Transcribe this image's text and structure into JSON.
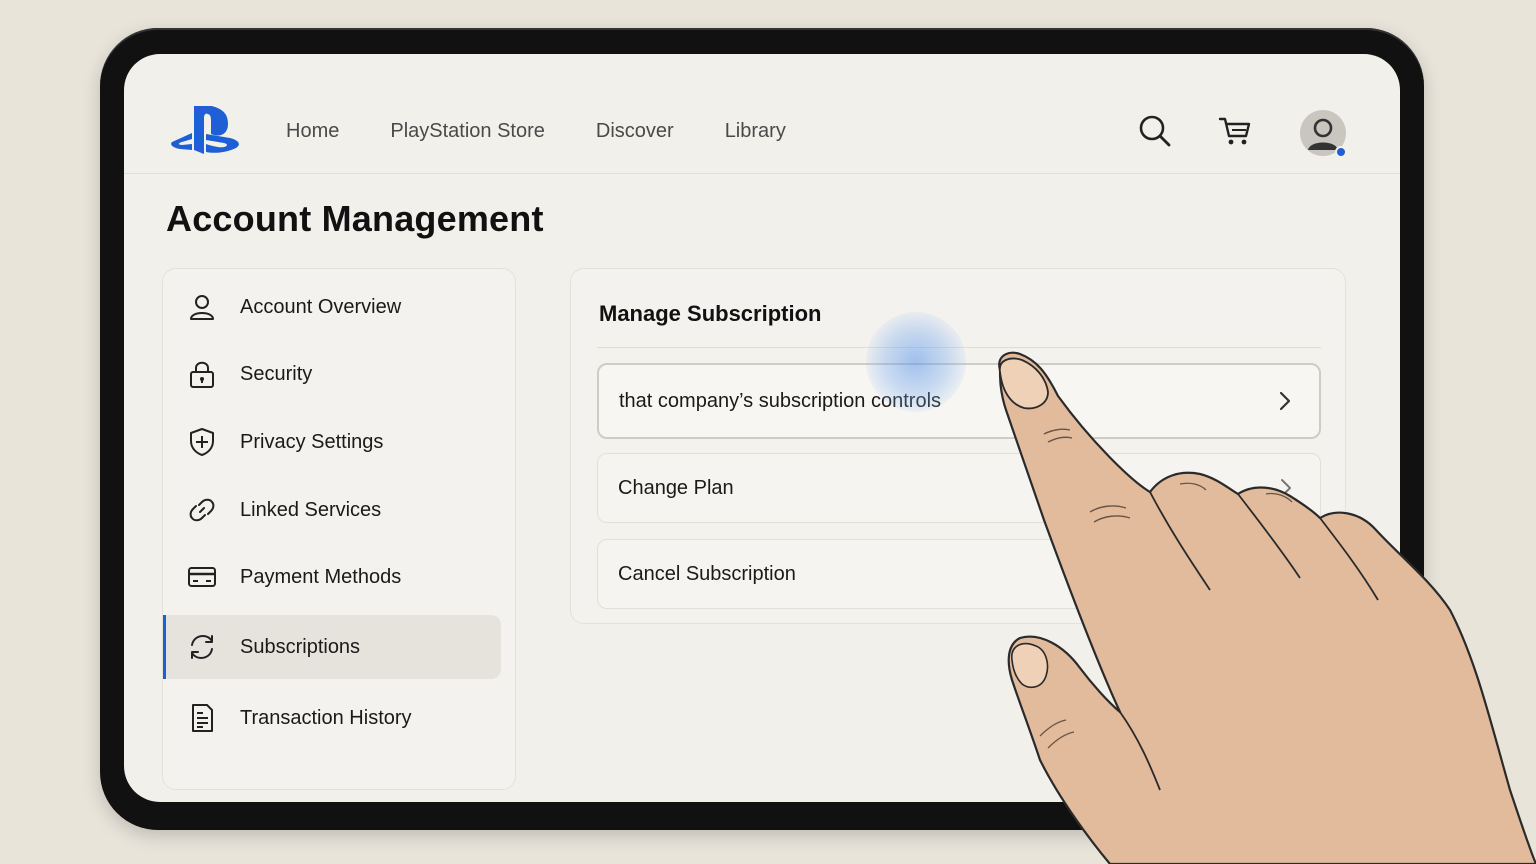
{
  "nav": {
    "links": [
      "Home",
      "PlayStation Store",
      "Discover",
      "Library"
    ],
    "icons": [
      "playstation-logo",
      "search-icon",
      "cart-icon",
      "avatar-icon"
    ]
  },
  "page": {
    "title": "Account Management"
  },
  "sidebar": {
    "items": [
      {
        "label": "Account Overview",
        "icon": "user-icon"
      },
      {
        "label": "Security",
        "icon": "lock-icon"
      },
      {
        "label": "Privacy Settings",
        "icon": "shield-plus-icon"
      },
      {
        "label": "Linked Services",
        "icon": "link-icon"
      },
      {
        "label": "Payment Methods",
        "icon": "credit-card-icon"
      },
      {
        "label": "Subscriptions",
        "icon": "sync-icon"
      },
      {
        "label": "Transaction History",
        "icon": "receipt-icon"
      }
    ],
    "active": "Subscriptions"
  },
  "panel": {
    "title": "Manage Subscription",
    "options": [
      {
        "label": "that company’s subscription controls",
        "chevron": true
      },
      {
        "label": "Change Plan",
        "chevron": true
      },
      {
        "label": "Cancel Subscription",
        "chevron": false
      }
    ]
  },
  "colors": {
    "accent": "#1e5fd6",
    "background": "#f2f0eb",
    "frame": "#111111"
  }
}
